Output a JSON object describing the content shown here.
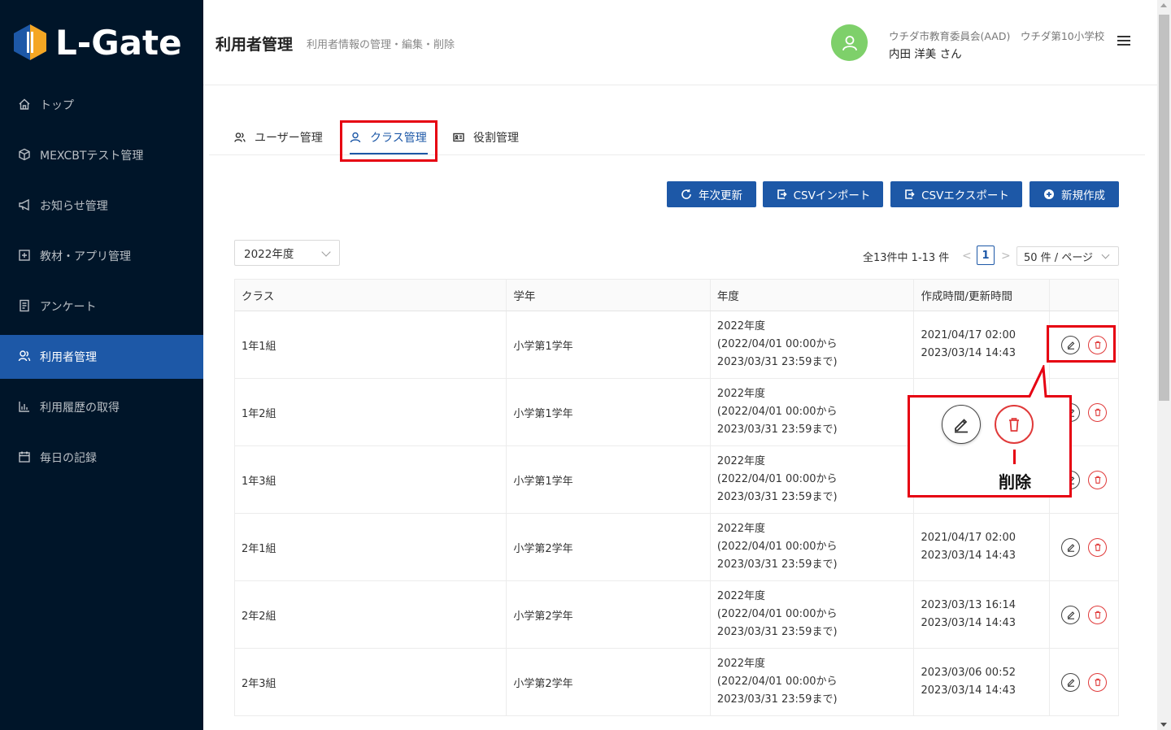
{
  "app": {
    "logo_text": "L-Gate"
  },
  "sidebar": {
    "items": [
      {
        "label": "トップ",
        "icon": "home-icon"
      },
      {
        "label": "MEXCBTテスト管理",
        "icon": "cube-icon"
      },
      {
        "label": "お知らせ管理",
        "icon": "megaphone-icon"
      },
      {
        "label": "教材・アプリ管理",
        "icon": "plus-square-icon"
      },
      {
        "label": "アンケート",
        "icon": "survey-icon"
      },
      {
        "label": "利用者管理",
        "icon": "users-icon",
        "active": true
      },
      {
        "label": "利用履歴の取得",
        "icon": "bar-chart-icon"
      },
      {
        "label": "毎日の記録",
        "icon": "calendar-icon"
      }
    ]
  },
  "header": {
    "title": "利用者管理",
    "subtitle": "利用者情報の管理・編集・削除",
    "org": "ウチダ市教育委員会(AAD)　ウチダ第10小学校",
    "user": "内田 洋美 さん"
  },
  "tabs": [
    {
      "label": "ユーザー管理",
      "icon": "users-icon"
    },
    {
      "label": "クラス管理",
      "icon": "user-icon",
      "active": true
    },
    {
      "label": "役割管理",
      "icon": "id-card-icon"
    }
  ],
  "actions": {
    "annual_update": "年次更新",
    "csv_import": "CSVインポート",
    "csv_export": "CSVエクスポート",
    "create_new": "新規作成"
  },
  "filter": {
    "year": "2022年度"
  },
  "pagination": {
    "total_text": "全13件中 1-13 件",
    "prev": "<",
    "current": "1",
    "next": ">",
    "page_size": "50 件 / ページ"
  },
  "table": {
    "headers": [
      "クラス",
      "学年",
      "年度",
      "作成時間/更新時間",
      ""
    ],
    "rows": [
      {
        "class": "1年1組",
        "grade": "小学第1学年",
        "year": "2022年度",
        "year_start": "(2022/04/01 00:00から",
        "year_end": "2023/03/31 23:59まで)",
        "created": "2021/04/17 02:00",
        "updated": "2023/03/14 14:43"
      },
      {
        "class": "1年2組",
        "grade": "小学第1学年",
        "year": "2022年度",
        "year_start": "(2022/04/01 00:00から",
        "year_end": "2023/03/31 23:59まで)",
        "created": "",
        "updated": ""
      },
      {
        "class": "1年3組",
        "grade": "小学第1学年",
        "year": "2022年度",
        "year_start": "(2022/04/01 00:00から",
        "year_end": "2023/03/31 23:59まで)",
        "created": "",
        "updated": ""
      },
      {
        "class": "2年1組",
        "grade": "小学第2学年",
        "year": "2022年度",
        "year_start": "(2022/04/01 00:00から",
        "year_end": "2023/03/31 23:59まで)",
        "created": "2021/04/17 02:00",
        "updated": "2023/03/14 14:43"
      },
      {
        "class": "2年2組",
        "grade": "小学第2学年",
        "year": "2022年度",
        "year_start": "(2022/04/01 00:00から",
        "year_end": "2023/03/31 23:59まで)",
        "created": "2023/03/13 16:14",
        "updated": "2023/03/14 14:43"
      },
      {
        "class": "2年3組",
        "grade": "小学第2学年",
        "year": "2022年度",
        "year_start": "(2022/04/01 00:00から",
        "year_end": "2023/03/31 23:59まで)",
        "created": "2023/03/06 00:52",
        "updated": "2023/03/14 14:43"
      }
    ]
  },
  "callout": {
    "label": "削除"
  },
  "colors": {
    "sidebar_bg": "#001529",
    "accent": "#1d58a7",
    "highlight": "#e60012",
    "avatar": "#7ed06a",
    "delete": "#e03a3a"
  }
}
